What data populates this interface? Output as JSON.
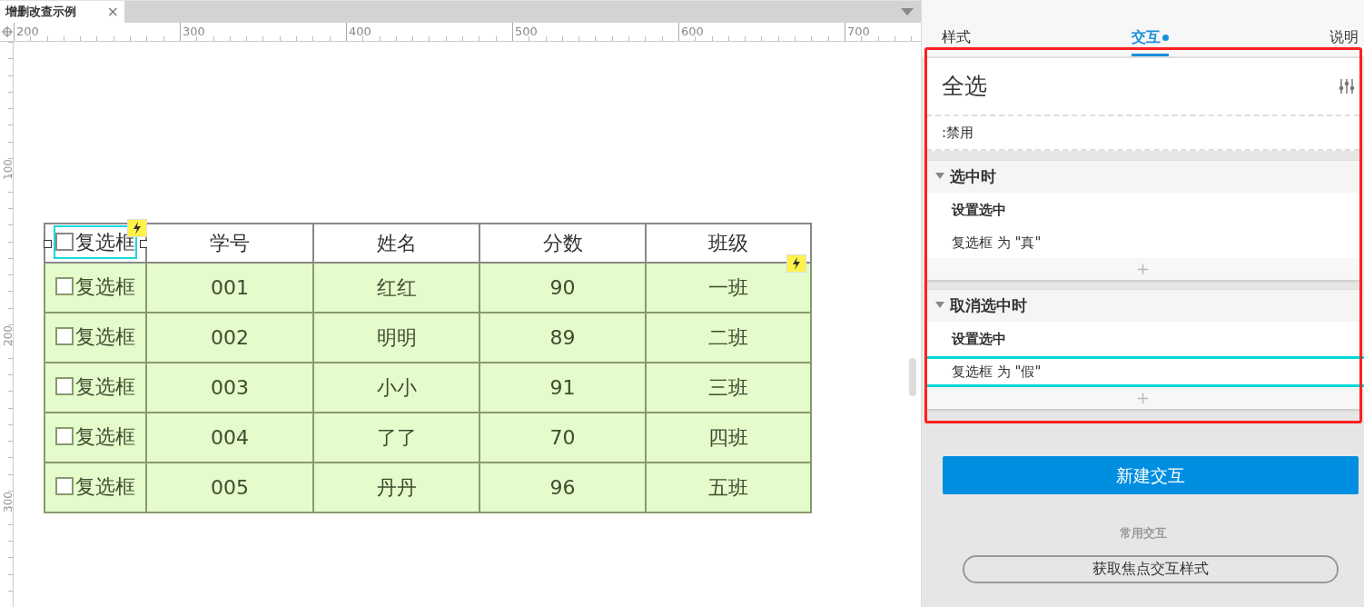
{
  "document_tabs": [
    {
      "label": "增删改查示例",
      "selected": true,
      "close": "×"
    }
  ],
  "ruler": {
    "h_labels": [
      "200",
      "300",
      "400",
      "500",
      "600",
      "700"
    ],
    "v_labels": [
      "100",
      "200",
      "300"
    ]
  },
  "table": {
    "header_checkbox": {
      "label": "复选框",
      "checked": false,
      "selected": true
    },
    "columns": [
      "学号",
      "姓名",
      "分数",
      "班级"
    ],
    "rows": [
      {
        "checkbox": "复选框",
        "checked": false,
        "cells": [
          "001",
          "红红",
          "90",
          "一班"
        ]
      },
      {
        "checkbox": "复选框",
        "checked": false,
        "cells": [
          "002",
          "明明",
          "89",
          "二班"
        ]
      },
      {
        "checkbox": "复选框",
        "checked": false,
        "cells": [
          "003",
          "小小",
          "91",
          "三班"
        ]
      },
      {
        "checkbox": "复选框",
        "checked": false,
        "cells": [
          "004",
          "了了",
          "70",
          "四班"
        ]
      },
      {
        "checkbox": "复选框",
        "checked": false,
        "cells": [
          "005",
          "丹丹",
          "96",
          "五班"
        ]
      }
    ]
  },
  "panel": {
    "tabs": [
      {
        "label": "样式",
        "selected": false,
        "dot": false
      },
      {
        "label": "交互",
        "selected": true,
        "dot": true
      },
      {
        "label": "说明",
        "selected": false,
        "dot": false
      }
    ],
    "widget_name": "全选",
    "state_label": ":禁用",
    "events": [
      {
        "title": "选中时",
        "expanded": true,
        "actions": [
          {
            "name": "设置选中",
            "details": [
              {
                "text": "复选框 为 \"真\"",
                "selected": false
              }
            ]
          }
        ],
        "add": "+"
      },
      {
        "title": "取消选中时",
        "expanded": true,
        "actions": [
          {
            "name": "设置选中",
            "details": [
              {
                "text": "复选框 为 \"假\"",
                "selected": true
              }
            ]
          }
        ],
        "add": "+"
      }
    ],
    "new_button": "新建交互",
    "common_label": "常用交互",
    "common_buttons": [
      "获取焦点交互样式"
    ]
  }
}
